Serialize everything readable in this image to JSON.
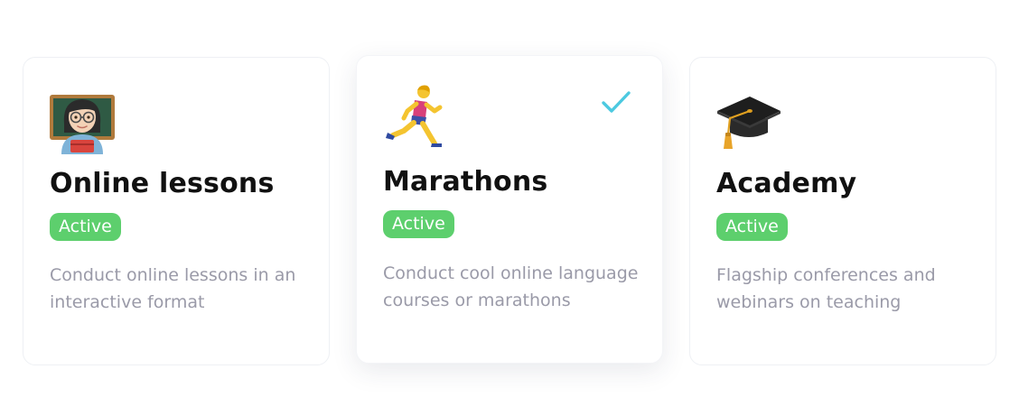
{
  "accent_color": "#4cc9e0",
  "badge_color": "#5dcf6d",
  "cards": [
    {
      "icon": "teacher-emoji",
      "title": "Online lessons",
      "badge": "Active",
      "description": "Conduct online lessons in an interactive format",
      "selected": false
    },
    {
      "icon": "runner-emoji",
      "title": "Marathons",
      "badge": "Active",
      "description": "Conduct cool online language courses or marathons",
      "selected": true
    },
    {
      "icon": "graduation-cap-emoji",
      "title": "Academy",
      "badge": "Active",
      "description": "Flagship conferences and webinars on teaching",
      "selected": false
    }
  ]
}
